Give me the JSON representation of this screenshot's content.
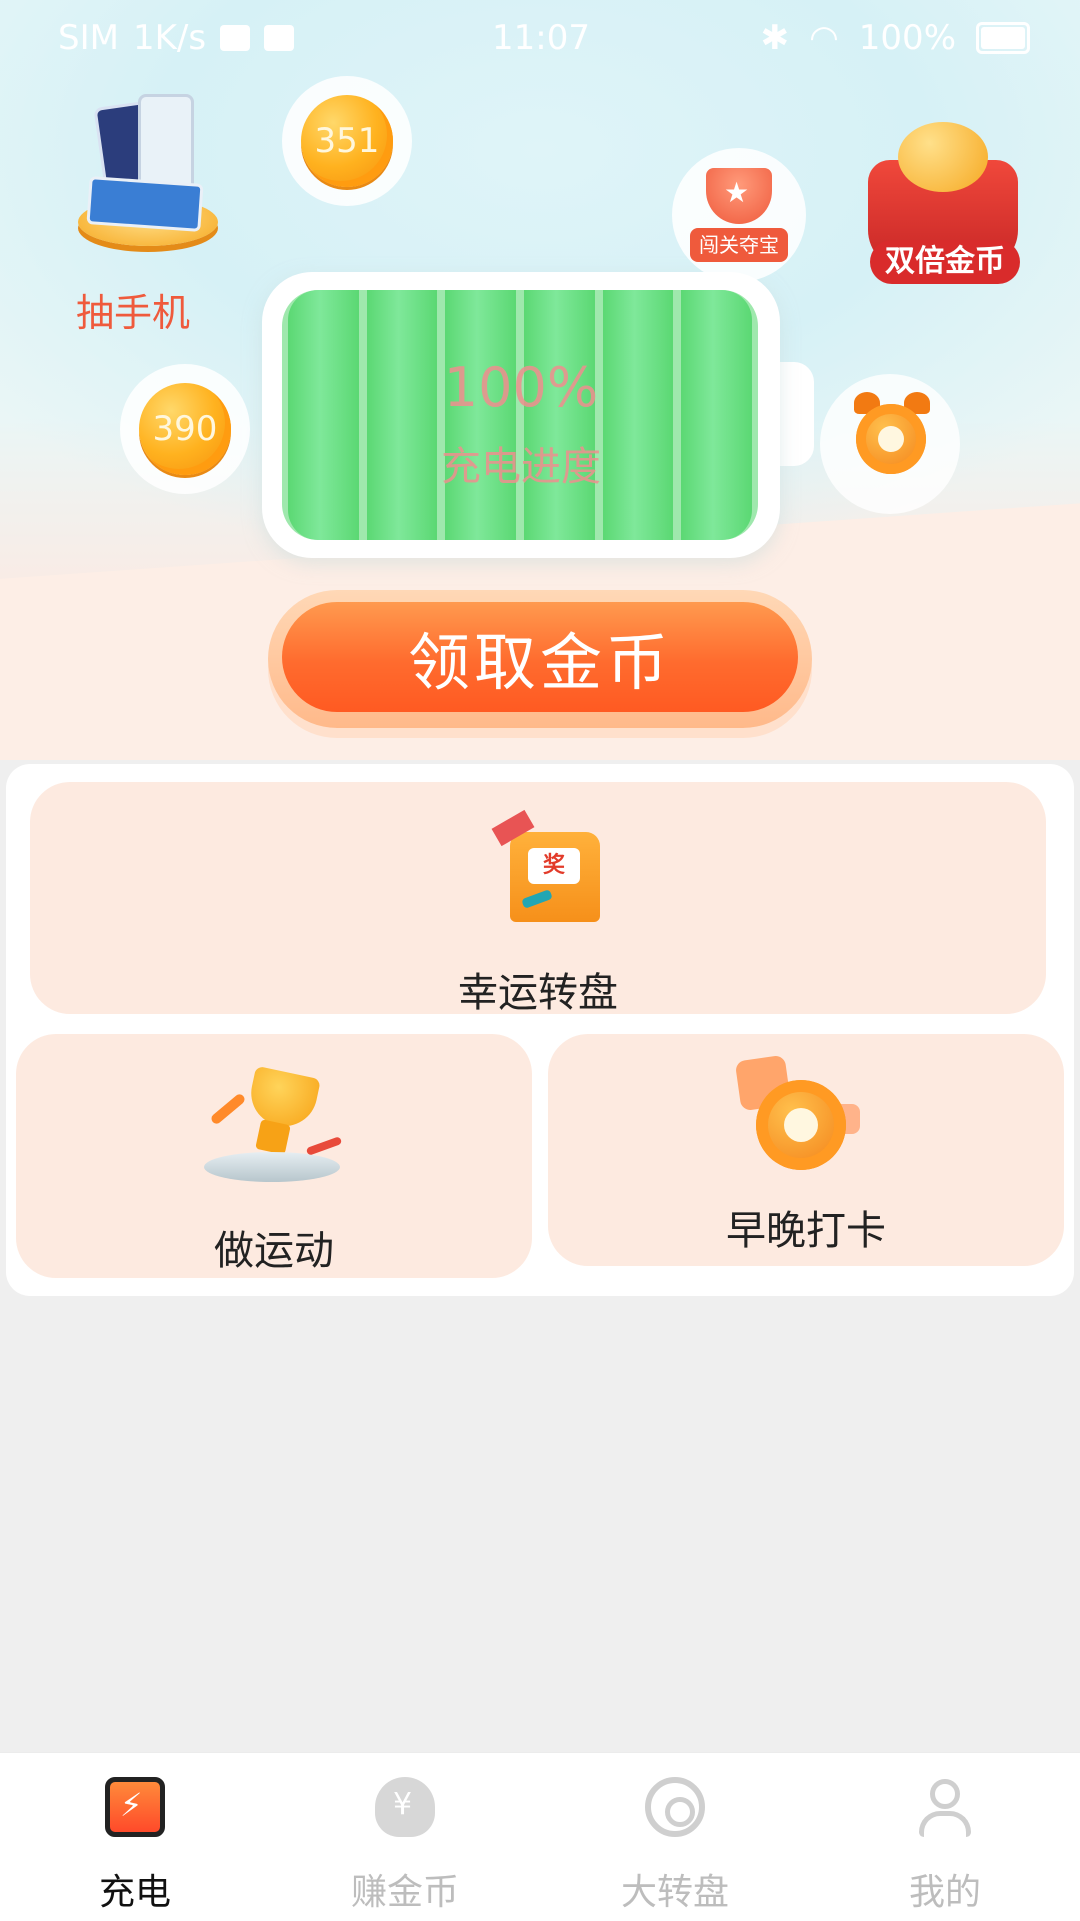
{
  "statusbar": {
    "carrier": "SIM",
    "speed": "1K/s",
    "time": "11:07",
    "battery": "100%"
  },
  "hero": {
    "prize_label": "抽手机",
    "coin_top_value": "351",
    "coin_left_value": "390",
    "trophy_tag": "闯关夺宝",
    "double_coin_label": "双倍金币",
    "battery_percent": "100%",
    "battery_subtitle": "充电进度",
    "claim_button": "领取金币"
  },
  "progress": {
    "charge_level": 1.0
  },
  "cards": {
    "lucky_wheel": "幸运转盘",
    "arcade_screen": "奖",
    "exercise": "做运动",
    "checkin": "早晚打卡"
  },
  "tabbar": {
    "items": [
      {
        "label": "充电",
        "icon": "charge-icon",
        "active": true
      },
      {
        "label": "赚金币",
        "icon": "money-bag-icon",
        "active": false
      },
      {
        "label": "大转盘",
        "icon": "wheel-icon",
        "active": false
      },
      {
        "label": "我的",
        "icon": "user-icon",
        "active": false
      }
    ]
  },
  "colors": {
    "accent": "#ff5a22",
    "card_bg": "#fdeae0",
    "battery_green": "#5bd873",
    "prize_text": "#ef5a3c"
  }
}
